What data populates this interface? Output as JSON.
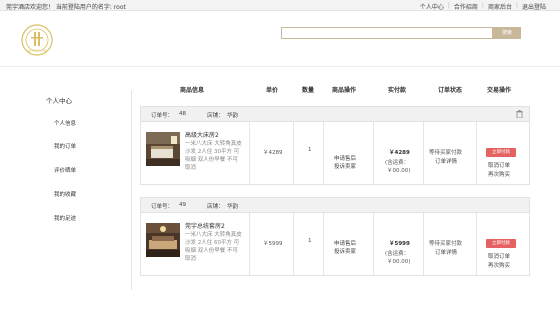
{
  "topbar": {
    "welcome": "莞宇酒店欢迎您！ 当前登陆用户的名字: root",
    "links": [
      "个人中心",
      "合作招商",
      "商家后台",
      "退出登陆"
    ]
  },
  "header": {
    "logo_text": "DONGGUAN",
    "search_placeholder": "",
    "search_button": "搜索"
  },
  "sidebar": {
    "title": "个人中心",
    "items": [
      "个人信息",
      "我的订单",
      "评价晒单",
      "我的收藏",
      "我的足迹"
    ]
  },
  "columns": [
    "商品信息",
    "单价",
    "数量",
    "商品操作",
    "实付款",
    "订单状态",
    "交易操作"
  ],
  "orders": [
    {
      "order_label": "订单号：",
      "order_no": "48",
      "store_label": "店铺：",
      "store_name": "华韵",
      "product_name": "高级大床房2",
      "product_desc": "一米八大床 大转角真皮沙发 2人住 30平方 可吸烟 双人份早餐 不可取消",
      "unit_price": "￥4289",
      "quantity": "1",
      "product_actions": [
        "申请售后",
        "投诉卖家"
      ],
      "paid": "￥4289",
      "shipping_label": "(含运费：",
      "shipping_fee": "￥00.00)",
      "status": [
        "等待买家付款",
        "订单详情"
      ],
      "pay_button": "立即付款",
      "trade_actions": [
        "取消订单",
        "再次购买"
      ]
    },
    {
      "order_label": "订单号：",
      "order_no": "49",
      "store_label": "店铺：",
      "store_name": "华韵",
      "product_name": "莞宇总统套房2",
      "product_desc": "一米八大床 大转角真皮沙发 2人住 60平方 可吸烟 双人份早餐 不可取消",
      "unit_price": "￥5999",
      "quantity": "1",
      "product_actions": [
        "申请售后",
        "投诉卖家"
      ],
      "paid": "￥5999",
      "shipping_label": "(含运费：",
      "shipping_fee": "￥00.00)",
      "status": [
        "等待买家付款",
        "订单详情"
      ],
      "pay_button": "立即付款",
      "trade_actions": [
        "取消订单",
        "再次购买"
      ]
    }
  ],
  "colors": {
    "accent": "#c9b79a",
    "pay_button": "#e56262",
    "header_bg": "#f1f1f1"
  }
}
